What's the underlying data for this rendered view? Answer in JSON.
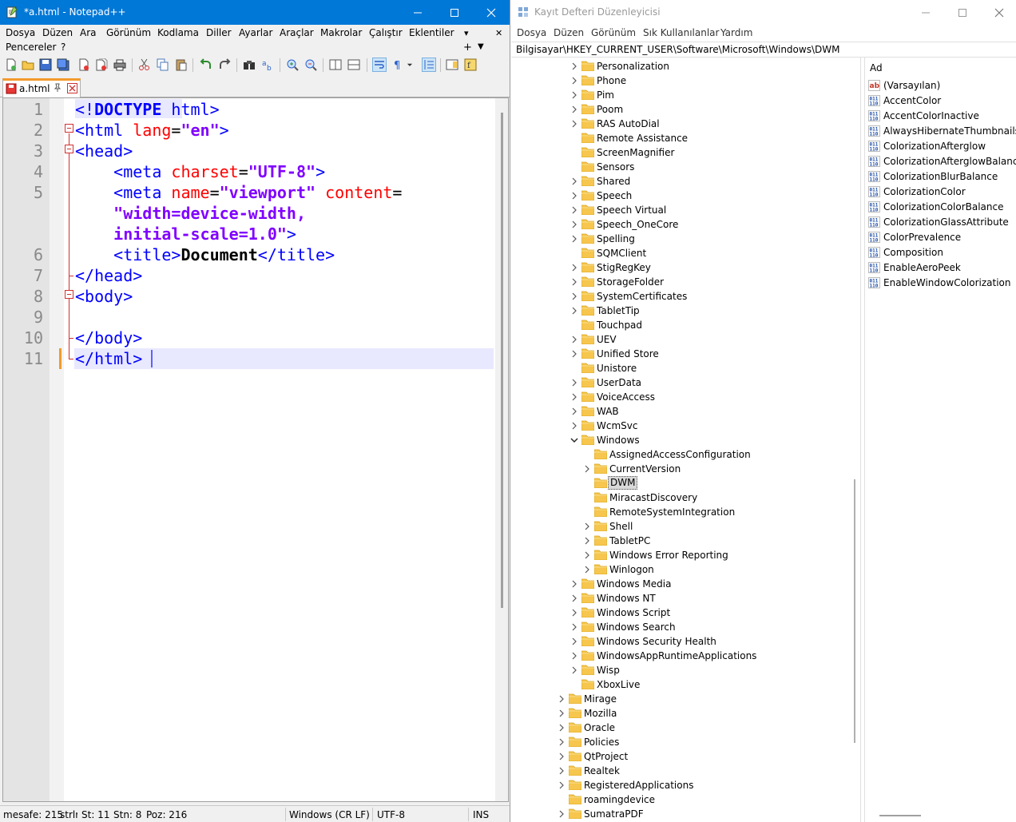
{
  "notepad": {
    "title": "*a.html - Notepad++",
    "menu_row1": [
      "Dosya",
      "Düzen",
      "Ara",
      "Görünüm",
      "Kodlama",
      "Diller",
      "Ayarlar",
      "Araçlar",
      "Makrolar",
      "Çalıştır",
      "Eklentiler"
    ],
    "menu_row2": [
      "Pencereler",
      "?"
    ],
    "menu_overflow_arrows": [
      "▾",
      "✕",
      "+",
      "▼"
    ],
    "tab_label": "a.html",
    "line_numbers": [
      "1",
      "2",
      "3",
      "4",
      "5",
      "6",
      "7",
      "8",
      "9",
      "10",
      "11"
    ],
    "code": {
      "l1_open": "<!",
      "l1_doctype": "DOCTYPE",
      "l1_html": " html",
      "l1_close": ">",
      "l2_tag": "<html ",
      "l2_attr": "lang",
      "l2_eq": "=",
      "l2_val": "\"en\"",
      "l2_close": ">",
      "l3_tag": "<head>",
      "l4_tag": "    <meta ",
      "l4_attr": "charset",
      "l4_eq": "=",
      "l4_val": "\"UTF-8\"",
      "l4_close": ">",
      "l5_tag": "    <meta ",
      "l5_attr1": "name",
      "l5_eq1": "=",
      "l5_val1": "\"viewport\"",
      "l5_sp": " ",
      "l5_attr2": "content",
      "l5_eq2": "=",
      "l5_wrap1": "    \"width=device-width,",
      "l5_wrap2": "    initial-scale=1.0\"",
      "l5_close": ">",
      "l6_open": "    <title>",
      "l6_text": "Document",
      "l6_close": "</title>",
      "l7_tag": "</head>",
      "l8_tag": "<body>",
      "l10_tag": "</body>",
      "l11_tag": "</html>"
    },
    "status": {
      "length": "mesafe: 215",
      "lines": "strlr",
      "ln": "St: 11",
      "col": "Stn: 8",
      "pos": "Poz: 216",
      "eol": "Windows (CR LF)",
      "encoding": "UTF-8",
      "mode": "INS"
    }
  },
  "regedit": {
    "title": "Kayıt Defteri Düzenleyicisi",
    "menu": [
      "Dosya",
      "Düzen",
      "Görünüm",
      "Sık Kullanılanlar",
      "Yardım"
    ],
    "address": "Bilgisayar\\HKEY_CURRENT_USER\\Software\\Microsoft\\Windows\\DWM",
    "tree": [
      {
        "label": "Personalization",
        "level": 2,
        "expandable": true
      },
      {
        "label": "Phone",
        "level": 2,
        "expandable": true
      },
      {
        "label": "Pim",
        "level": 2,
        "expandable": true
      },
      {
        "label": "Poom",
        "level": 2,
        "expandable": true
      },
      {
        "label": "RAS AutoDial",
        "level": 2,
        "expandable": true
      },
      {
        "label": "Remote Assistance",
        "level": 2,
        "expandable": false
      },
      {
        "label": "ScreenMagnifier",
        "level": 2,
        "expandable": false
      },
      {
        "label": "Sensors",
        "level": 2,
        "expandable": false
      },
      {
        "label": "Shared",
        "level": 2,
        "expandable": true
      },
      {
        "label": "Speech",
        "level": 2,
        "expandable": true
      },
      {
        "label": "Speech Virtual",
        "level": 2,
        "expandable": true
      },
      {
        "label": "Speech_OneCore",
        "level": 2,
        "expandable": true
      },
      {
        "label": "Spelling",
        "level": 2,
        "expandable": true
      },
      {
        "label": "SQMClient",
        "level": 2,
        "expandable": false
      },
      {
        "label": "StigRegKey",
        "level": 2,
        "expandable": true
      },
      {
        "label": "StorageFolder",
        "level": 2,
        "expandable": true
      },
      {
        "label": "SystemCertificates",
        "level": 2,
        "expandable": true
      },
      {
        "label": "TabletTip",
        "level": 2,
        "expandable": true
      },
      {
        "label": "Touchpad",
        "level": 2,
        "expandable": false
      },
      {
        "label": "UEV",
        "level": 2,
        "expandable": true
      },
      {
        "label": "Unified Store",
        "level": 2,
        "expandable": true
      },
      {
        "label": "Unistore",
        "level": 2,
        "expandable": false
      },
      {
        "label": "UserData",
        "level": 2,
        "expandable": true
      },
      {
        "label": "VoiceAccess",
        "level": 2,
        "expandable": true
      },
      {
        "label": "WAB",
        "level": 2,
        "expandable": true
      },
      {
        "label": "WcmSvc",
        "level": 2,
        "expandable": true
      },
      {
        "label": "Windows",
        "level": 2,
        "expandable": true,
        "expanded": true
      },
      {
        "label": "AssignedAccessConfiguration",
        "level": 3,
        "expandable": false
      },
      {
        "label": "CurrentVersion",
        "level": 3,
        "expandable": true
      },
      {
        "label": "DWM",
        "level": 3,
        "expandable": false,
        "selected": true
      },
      {
        "label": "MiracastDiscovery",
        "level": 3,
        "expandable": false
      },
      {
        "label": "RemoteSystemIntegration",
        "level": 3,
        "expandable": false
      },
      {
        "label": "Shell",
        "level": 3,
        "expandable": true
      },
      {
        "label": "TabletPC",
        "level": 3,
        "expandable": true
      },
      {
        "label": "Windows Error Reporting",
        "level": 3,
        "expandable": true
      },
      {
        "label": "Winlogon",
        "level": 3,
        "expandable": true
      },
      {
        "label": "Windows Media",
        "level": 2,
        "expandable": true
      },
      {
        "label": "Windows NT",
        "level": 2,
        "expandable": true
      },
      {
        "label": "Windows Script",
        "level": 2,
        "expandable": true
      },
      {
        "label": "Windows Search",
        "level": 2,
        "expandable": true
      },
      {
        "label": "Windows Security Health",
        "level": 2,
        "expandable": true
      },
      {
        "label": "WindowsAppRuntimeApplications",
        "level": 2,
        "expandable": true
      },
      {
        "label": "Wisp",
        "level": 2,
        "expandable": true
      },
      {
        "label": "XboxLive",
        "level": 2,
        "expandable": false
      },
      {
        "label": "Mirage",
        "level": 1,
        "expandable": true
      },
      {
        "label": "Mozilla",
        "level": 1,
        "expandable": true
      },
      {
        "label": "Oracle",
        "level": 1,
        "expandable": true
      },
      {
        "label": "Policies",
        "level": 1,
        "expandable": true
      },
      {
        "label": "QtProject",
        "level": 1,
        "expandable": true
      },
      {
        "label": "Realtek",
        "level": 1,
        "expandable": true
      },
      {
        "label": "RegisteredApplications",
        "level": 1,
        "expandable": true
      },
      {
        "label": "roamingdevice",
        "level": 1,
        "expandable": false
      },
      {
        "label": "SumatraPDF",
        "level": 1,
        "expandable": true
      }
    ],
    "values_header": "Ad",
    "values": [
      {
        "name": "(Varsayılan)",
        "type": "string"
      },
      {
        "name": "AccentColor",
        "type": "binary"
      },
      {
        "name": "AccentColorInactive",
        "type": "binary"
      },
      {
        "name": "AlwaysHibernateThumbnails",
        "type": "binary"
      },
      {
        "name": "ColorizationAfterglow",
        "type": "binary"
      },
      {
        "name": "ColorizationAfterglowBalance",
        "type": "binary"
      },
      {
        "name": "ColorizationBlurBalance",
        "type": "binary"
      },
      {
        "name": "ColorizationColor",
        "type": "binary"
      },
      {
        "name": "ColorizationColorBalance",
        "type": "binary"
      },
      {
        "name": "ColorizationGlassAttribute",
        "type": "binary"
      },
      {
        "name": "ColorPrevalence",
        "type": "binary"
      },
      {
        "name": "Composition",
        "type": "binary"
      },
      {
        "name": "EnableAeroPeek",
        "type": "binary"
      },
      {
        "name": "EnableWindowColorization",
        "type": "binary"
      }
    ]
  },
  "colors": {
    "npp_titlebar": "#0078d7",
    "folder": "#f6c64e",
    "current_line": "#e8e8ff",
    "tag": "#0000ff",
    "attr": "#ff0000",
    "string": "#8000ff",
    "tab_accent": "#f39a2b"
  }
}
